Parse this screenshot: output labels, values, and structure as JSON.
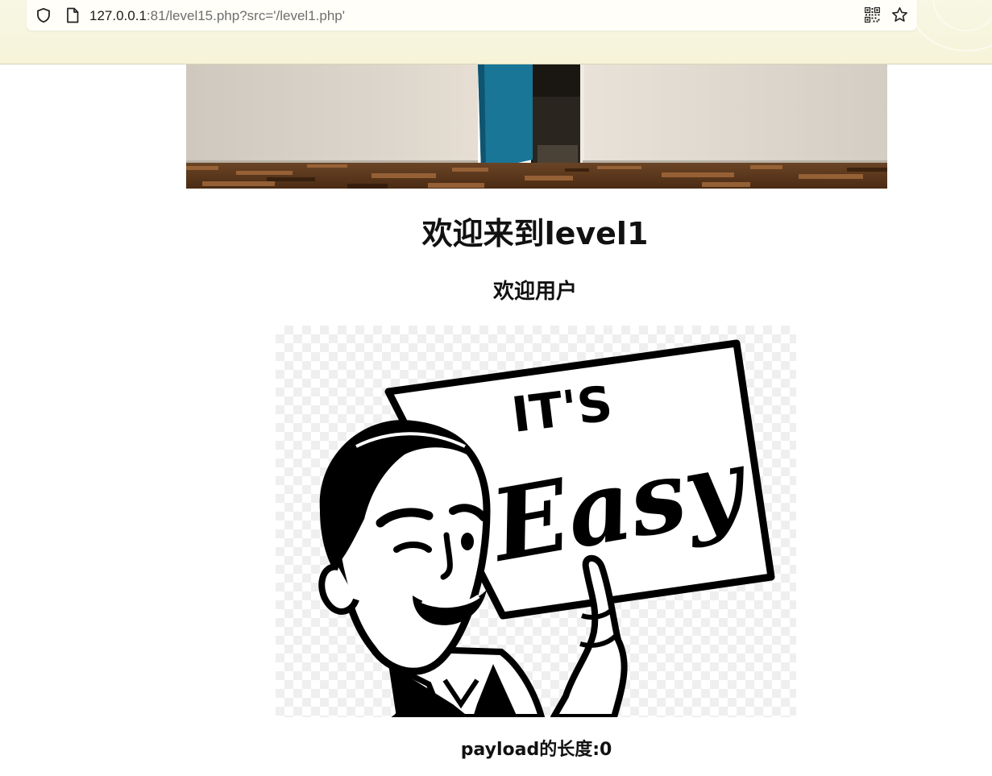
{
  "browser": {
    "url_host": "127.0.0.1",
    "url_rest": ":81/level15.php?src='/level1.php'",
    "icons": [
      "shield-icon",
      "file-icon",
      "qr-code-icon",
      "bookmark-star-icon"
    ]
  },
  "page": {
    "title": "欢迎来到level1",
    "welcome": "欢迎用户",
    "payload_label": "payload的长度:0"
  },
  "image": {
    "text_its": "IT'S",
    "text_easy": "Easy"
  }
}
